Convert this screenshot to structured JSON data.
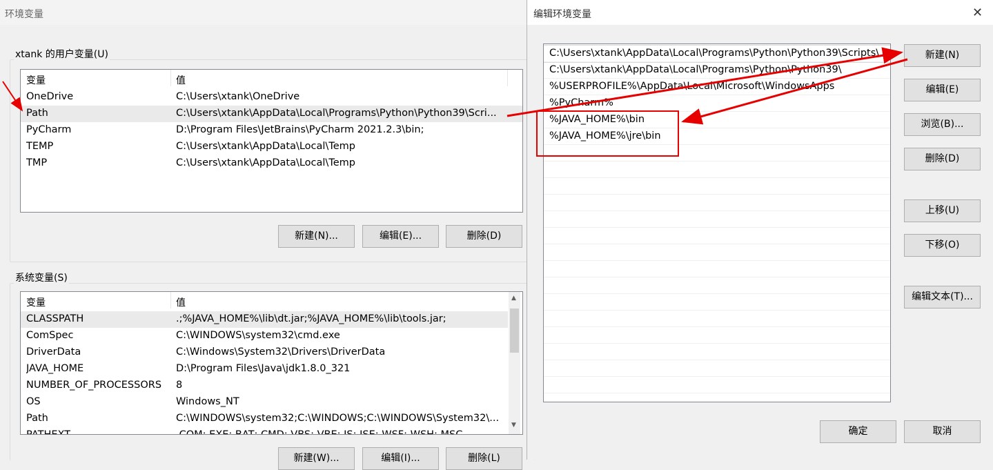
{
  "background_window": {
    "title": "环境变量",
    "user_vars": {
      "group_label": "xtank 的用户变量(U)",
      "columns": [
        "变量",
        "值"
      ],
      "rows": [
        {
          "name": "OneDrive",
          "value": "C:\\Users\\xtank\\OneDrive"
        },
        {
          "name": "Path",
          "value": "C:\\Users\\xtank\\AppData\\Local\\Programs\\Python\\Python39\\Scri..."
        },
        {
          "name": "PyCharm",
          "value": "D:\\Program Files\\JetBrains\\PyCharm 2021.2.3\\bin;"
        },
        {
          "name": "TEMP",
          "value": "C:\\Users\\xtank\\AppData\\Local\\Temp"
        },
        {
          "name": "TMP",
          "value": "C:\\Users\\xtank\\AppData\\Local\\Temp"
        }
      ],
      "buttons": {
        "new": "新建(N)...",
        "edit": "编辑(E)...",
        "delete": "删除(D)"
      }
    },
    "system_vars": {
      "group_label": "系统变量(S)",
      "columns": [
        "变量",
        "值"
      ],
      "rows": [
        {
          "name": "CLASSPATH",
          "value": ".;%JAVA_HOME%\\lib\\dt.jar;%JAVA_HOME%\\lib\\tools.jar;"
        },
        {
          "name": "ComSpec",
          "value": "C:\\WINDOWS\\system32\\cmd.exe"
        },
        {
          "name": "DriverData",
          "value": "C:\\Windows\\System32\\Drivers\\DriverData"
        },
        {
          "name": "JAVA_HOME",
          "value": "D:\\Program Files\\Java\\jdk1.8.0_321"
        },
        {
          "name": "NUMBER_OF_PROCESSORS",
          "value": "8"
        },
        {
          "name": "OS",
          "value": "Windows_NT"
        },
        {
          "name": "Path",
          "value": "C:\\WINDOWS\\system32;C:\\WINDOWS;C:\\WINDOWS\\System32\\..."
        },
        {
          "name": "PATHEXT",
          "value": ".COM;.EXE;.BAT;.CMD;.VBS;.VBE;.JS;.JSE;.WSF;.WSH;.MSC"
        }
      ],
      "buttons": {
        "new": "新建(W)...",
        "edit": "编辑(I)...",
        "delete": "删除(L)"
      }
    }
  },
  "dialog": {
    "title": "编辑环境变量",
    "close_glyph": "✕",
    "path_entries": [
      "C:\\Users\\xtank\\AppData\\Local\\Programs\\Python\\Python39\\Scripts\\",
      "C:\\Users\\xtank\\AppData\\Local\\Programs\\Python\\Python39\\",
      "%USERPROFILE%\\AppData\\Local\\Microsoft\\WindowsApps",
      "%PyCharm%",
      "%JAVA_HOME%\\bin",
      "%JAVA_HOME%\\jre\\bin"
    ],
    "buttons": {
      "new": "新建(N)",
      "edit": "编辑(E)",
      "browse": "浏览(B)...",
      "delete": "删除(D)",
      "move_up": "上移(U)",
      "move_down": "下移(O)",
      "edit_text": "编辑文本(T)...",
      "ok": "确定",
      "cancel": "取消"
    }
  },
  "annotation_color": "#e60000"
}
